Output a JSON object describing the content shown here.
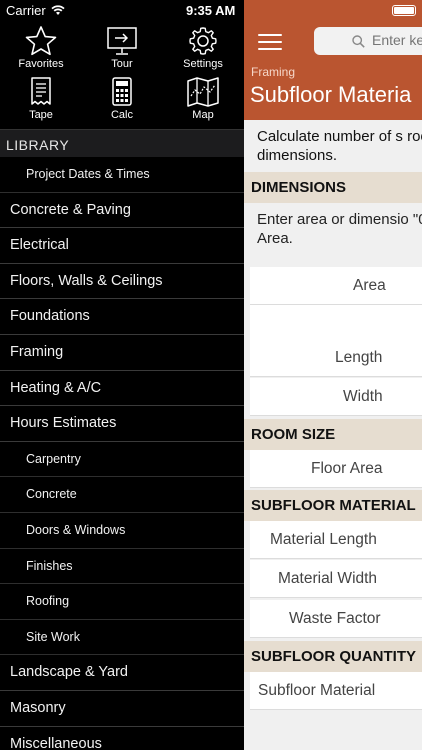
{
  "status": {
    "carrier": "Carrier",
    "time": "9:35 AM"
  },
  "toolbar": {
    "favorites": "Favorites",
    "tour": "Tour",
    "settings": "Settings",
    "tape": "Tape",
    "calc": "Calc",
    "map": "Map"
  },
  "library": {
    "header": "LIBRARY",
    "items": [
      {
        "label": "Project Dates & Times",
        "sub": true
      },
      {
        "label": "Concrete & Paving",
        "sub": false
      },
      {
        "label": "Electrical",
        "sub": false
      },
      {
        "label": "Floors, Walls & Ceilings",
        "sub": false
      },
      {
        "label": "Foundations",
        "sub": false
      },
      {
        "label": "Framing",
        "sub": false
      },
      {
        "label": "Heating & A/C",
        "sub": false
      },
      {
        "label": "Hours Estimates",
        "sub": false
      },
      {
        "label": "Carpentry",
        "sub": true
      },
      {
        "label": "Concrete",
        "sub": true
      },
      {
        "label": "Doors & Windows",
        "sub": true
      },
      {
        "label": "Finishes",
        "sub": true
      },
      {
        "label": "Roofing",
        "sub": true
      },
      {
        "label": "Site Work",
        "sub": true
      },
      {
        "label": "Landscape & Yard",
        "sub": false
      },
      {
        "label": "Masonry",
        "sub": false
      },
      {
        "label": "Miscellaneous",
        "sub": false
      }
    ]
  },
  "main": {
    "search_placeholder": "Enter ke",
    "breadcrumb": "Framing",
    "title": "Subfloor Materia",
    "description": "Calculate number of s room dimensions.",
    "sections": {
      "dimensions": "DIMENSIONS",
      "room_size": "ROOM SIZE",
      "subfloor_material": "SUBFLOOR MATERIAL",
      "subfloor_quantity": "SUBFLOOR QUANTITY"
    },
    "dimensions_note": "Enter area or dimensio \"0\" in Area.",
    "fields": {
      "area": "Area",
      "length": "Length",
      "width": "Width",
      "floor_area": "Floor Area",
      "material_length": "Material Length",
      "material_width": "Material Width",
      "waste_factor": "Waste Factor",
      "subfloor_material": "Subfloor Material"
    }
  },
  "colors": {
    "accent": "#ba5530",
    "section_bg": "#e6ddd0",
    "sidebar_bg": "#000000"
  }
}
